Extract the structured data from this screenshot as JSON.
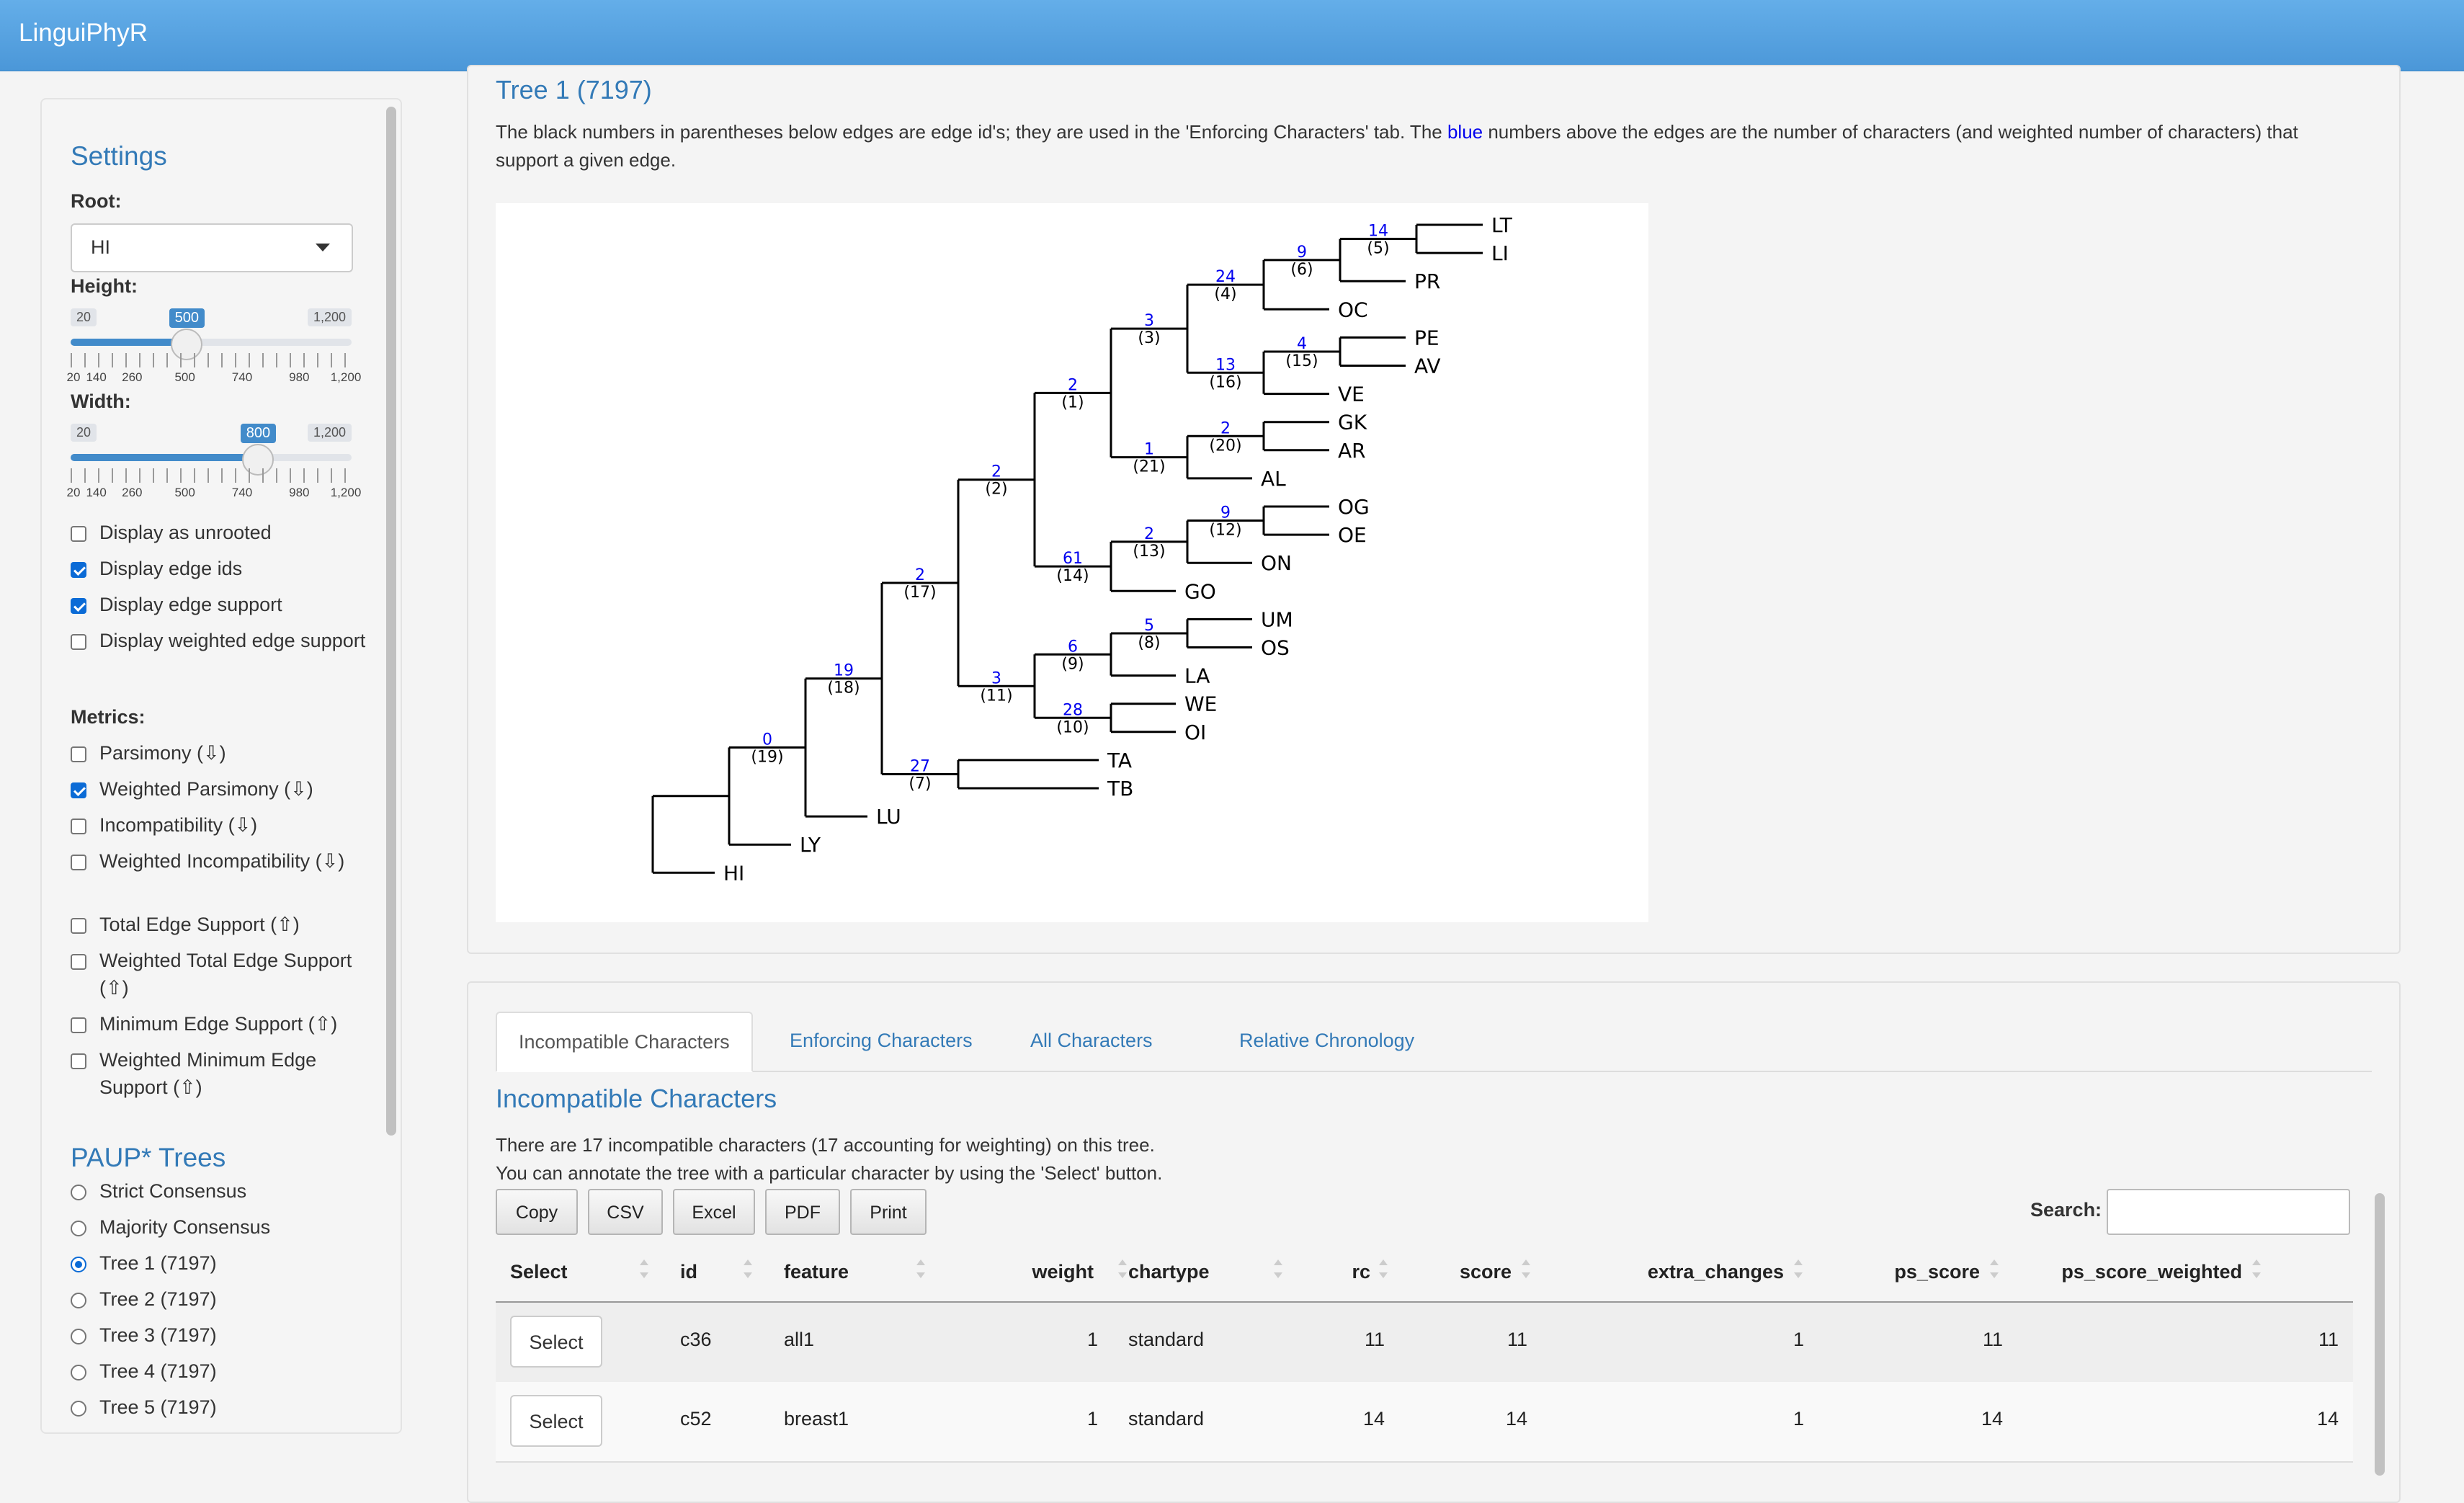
{
  "app": {
    "brand": "LinguiPhyR"
  },
  "sidebar": {
    "settings_title": "Settings",
    "root_label": "Root:",
    "root_value": "HI",
    "height": {
      "label": "Height:",
      "min": "20",
      "max": "1,200",
      "value": "500",
      "fraction": 0.4068,
      "ticks": [
        "20",
        "140",
        "260",
        "500",
        "740",
        "980",
        "1,200"
      ]
    },
    "width": {
      "label": "Width:",
      "min": "20",
      "max": "1,200",
      "value": "800",
      "fraction": 0.661,
      "ticks": [
        "20",
        "140",
        "260",
        "500",
        "740",
        "980",
        "1,200"
      ]
    },
    "display_options": [
      {
        "label": "Display as unrooted",
        "checked": false
      },
      {
        "label": "Display edge ids",
        "checked": true
      },
      {
        "label": "Display edge support",
        "checked": true
      },
      {
        "label": "Display weighted edge support",
        "checked": false
      }
    ],
    "metrics_label": "Metrics:",
    "metrics": [
      {
        "label": "Parsimony (⇩)",
        "checked": false
      },
      {
        "label": "Weighted Parsimony (⇩)",
        "checked": true
      },
      {
        "label": "Incompatibility (⇩)",
        "checked": false
      },
      {
        "label": "Weighted Incompatibility (⇩)",
        "checked": false
      },
      {
        "label": "Total Edge Support (⇧)",
        "checked": false
      },
      {
        "label": "Weighted Total Edge Support (⇧)",
        "checked": false
      },
      {
        "label": "Minimum Edge Support (⇧)",
        "checked": false
      },
      {
        "label": "Weighted Minimum Edge Support (⇧)",
        "checked": false
      }
    ],
    "paup_title": "PAUP* Trees",
    "paup_trees": [
      {
        "label": "Strict Consensus",
        "selected": false
      },
      {
        "label": "Majority Consensus",
        "selected": false
      },
      {
        "label": "Tree 1 (7197)",
        "selected": true
      },
      {
        "label": "Tree 2 (7197)",
        "selected": false
      },
      {
        "label": "Tree 3 (7197)",
        "selected": false
      },
      {
        "label": "Tree 4 (7197)",
        "selected": false
      },
      {
        "label": "Tree 5 (7197)",
        "selected": false
      }
    ]
  },
  "tree_panel": {
    "title": "Tree 1 (7197)",
    "desc_part1": "The black numbers in parentheses below edges are edge id's; they are used in the 'Enforcing Characters' tab. The ",
    "desc_blue": "blue",
    "desc_part2": " numbers above the edges are the number of characters (and weighted number of characters) that support a given edge.",
    "colors": {
      "support": "#0000ee",
      "edge_id": "#000000"
    }
  },
  "tree": {
    "leaves": [
      "LT",
      "LI",
      "PR",
      "OC",
      "PE",
      "AV",
      "VE",
      "GK",
      "AR",
      "AL",
      "OG",
      "OE",
      "ON",
      "GO",
      "UM",
      "OS",
      "LA",
      "WE",
      "OI",
      "TA",
      "TB",
      "LU",
      "LY",
      "HI"
    ],
    "nodes": [
      {
        "name": "n4",
        "support": "14",
        "id": "(5)",
        "children": [
          "LT",
          "LI"
        ]
      },
      {
        "name": "n5",
        "support": "9",
        "id": "(6)",
        "children": [
          "n4",
          "PR"
        ]
      },
      {
        "name": "n6",
        "support": "24",
        "id": "(4)",
        "children": [
          "n5",
          "OC"
        ]
      },
      {
        "name": "n7",
        "support": "4",
        "id": "(15)",
        "children": [
          "PE",
          "AV"
        ]
      },
      {
        "name": "n8",
        "support": "13",
        "id": "(16)",
        "children": [
          "n7",
          "VE"
        ]
      },
      {
        "name": "n9",
        "support": "3",
        "id": "(3)",
        "children": [
          "n6",
          "n8"
        ]
      },
      {
        "name": "n10",
        "support": "2",
        "id": "(20)",
        "children": [
          "GK",
          "AR"
        ]
      },
      {
        "name": "n11",
        "support": "1",
        "id": "(21)",
        "children": [
          "n10",
          "AL"
        ]
      },
      {
        "name": "n12",
        "support": "2",
        "id": "(1)",
        "children": [
          "n9",
          "n11"
        ]
      },
      {
        "name": "n13",
        "support": "9",
        "id": "(12)",
        "children": [
          "OG",
          "OE"
        ]
      },
      {
        "name": "n14",
        "support": "2",
        "id": "(13)",
        "children": [
          "n13",
          "ON"
        ]
      },
      {
        "name": "n15",
        "support": "61",
        "id": "(14)",
        "children": [
          "n14",
          "GO"
        ]
      },
      {
        "name": "n16",
        "support": "2",
        "id": "(2)",
        "children": [
          "n12",
          "n15"
        ]
      },
      {
        "name": "n17",
        "support": "5",
        "id": "(8)",
        "children": [
          "UM",
          "OS"
        ]
      },
      {
        "name": "n18",
        "support": "6",
        "id": "(9)",
        "children": [
          "n17",
          "LA"
        ]
      },
      {
        "name": "n19",
        "support": "28",
        "id": "(10)",
        "children": [
          "WE",
          "OI"
        ]
      },
      {
        "name": "n20",
        "support": "3",
        "id": "(11)",
        "children": [
          "n18",
          "n19"
        ]
      },
      {
        "name": "n21",
        "support": "2",
        "id": "(17)",
        "children": [
          "n16",
          "n20"
        ]
      },
      {
        "name": "n22",
        "support": "27",
        "id": "(7)",
        "children": [
          "TA",
          "TB"
        ]
      },
      {
        "name": "n23",
        "support": "19",
        "id": "(18)",
        "children": [
          "n21",
          "n22"
        ]
      },
      {
        "name": "n24",
        "support": "0",
        "id": "(19)",
        "children": [
          "n23",
          "LU"
        ]
      },
      {
        "name": "n25",
        "support": "",
        "id": "",
        "children": [
          "n24",
          "LY"
        ]
      },
      {
        "name": "root",
        "support": "",
        "id": "",
        "children": [
          "n25",
          "HI"
        ]
      }
    ]
  },
  "char_panel": {
    "tabs": [
      "Incompatible Characters",
      "Enforcing Characters",
      "All Characters",
      "Relative Chronology"
    ],
    "active_tab": 0,
    "heading": "Incompatible Characters",
    "line1": "There are 17 incompatible characters (17 accounting for weighting) on this tree.",
    "line2": "You can annotate the tree with a particular character by using the 'Select' button.",
    "buttons": [
      "Copy",
      "CSV",
      "Excel",
      "PDF",
      "Print"
    ],
    "search_label": "Search:",
    "search_value": "",
    "columns": [
      "Select",
      "id",
      "feature",
      "weight",
      "chartype",
      "rc",
      "score",
      "extra_changes",
      "ps_score",
      "ps_score_weighted"
    ],
    "rows": [
      {
        "select": "Select",
        "id": "c36",
        "feature": "all1",
        "weight": "1",
        "chartype": "standard",
        "rc": "11",
        "score": "11",
        "extra_changes": "1",
        "ps_score": "11",
        "ps_score_weighted": "11"
      },
      {
        "select": "Select",
        "id": "c52",
        "feature": "breast1",
        "weight": "1",
        "chartype": "standard",
        "rc": "14",
        "score": "14",
        "extra_changes": "1",
        "ps_score": "14",
        "ps_score_weighted": "14"
      }
    ]
  }
}
